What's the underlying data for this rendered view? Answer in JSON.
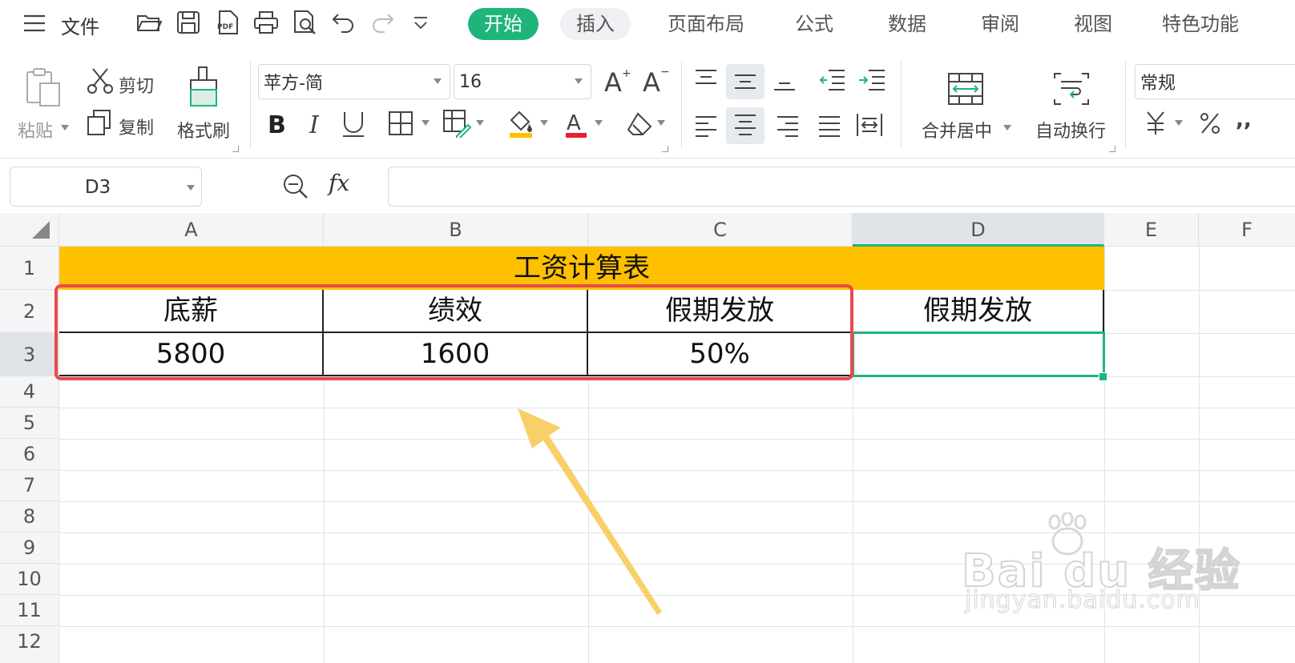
{
  "menubar": {
    "file_label": "文件",
    "tabs": [
      {
        "label": "开始",
        "active": true
      },
      {
        "label": "插入"
      },
      {
        "label": "页面布局"
      },
      {
        "label": "公式"
      },
      {
        "label": "数据"
      },
      {
        "label": "审阅"
      },
      {
        "label": "视图"
      },
      {
        "label": "特色功能"
      }
    ],
    "toolbar_icons": [
      "menu-icon",
      "open-folder-icon",
      "save-icon",
      "export-pdf-icon",
      "print-icon",
      "print-preview-icon",
      "undo-icon",
      "redo-icon",
      "more-icon"
    ]
  },
  "ribbon": {
    "paste_label": "粘贴",
    "cut_label": "剪切",
    "copy_label": "复制",
    "format_painter_label": "格式刷",
    "font_name": "苹方-简",
    "font_size": "16",
    "merge_center_label": "合并居中",
    "wrap_text_label": "自动换行",
    "number_format": "常规"
  },
  "formula_bar": {
    "cell_ref": "D3",
    "fx_label": "fx",
    "formula": ""
  },
  "sheet": {
    "columns": [
      "A",
      "B",
      "C",
      "D",
      "E",
      "F"
    ],
    "rows": [
      "1",
      "2",
      "3",
      "4",
      "5",
      "6",
      "7",
      "8",
      "9",
      "10",
      "11",
      "12"
    ],
    "selected_column": "D",
    "selected_row": "3",
    "title": "工资计算表",
    "headers": [
      "底薪",
      "绩效",
      "假期发放",
      "假期发放"
    ],
    "values": [
      "5800",
      "1600",
      "50%"
    ],
    "title_fill_color": "#ffc000",
    "selection_color": "#1fb57a",
    "highlight_box_color": "#e84a4a",
    "arrow_color": "#f7cc5a"
  },
  "watermark": {
    "brand_text": "Bai du 经验",
    "url_text": "jingyan.baidu.com"
  }
}
